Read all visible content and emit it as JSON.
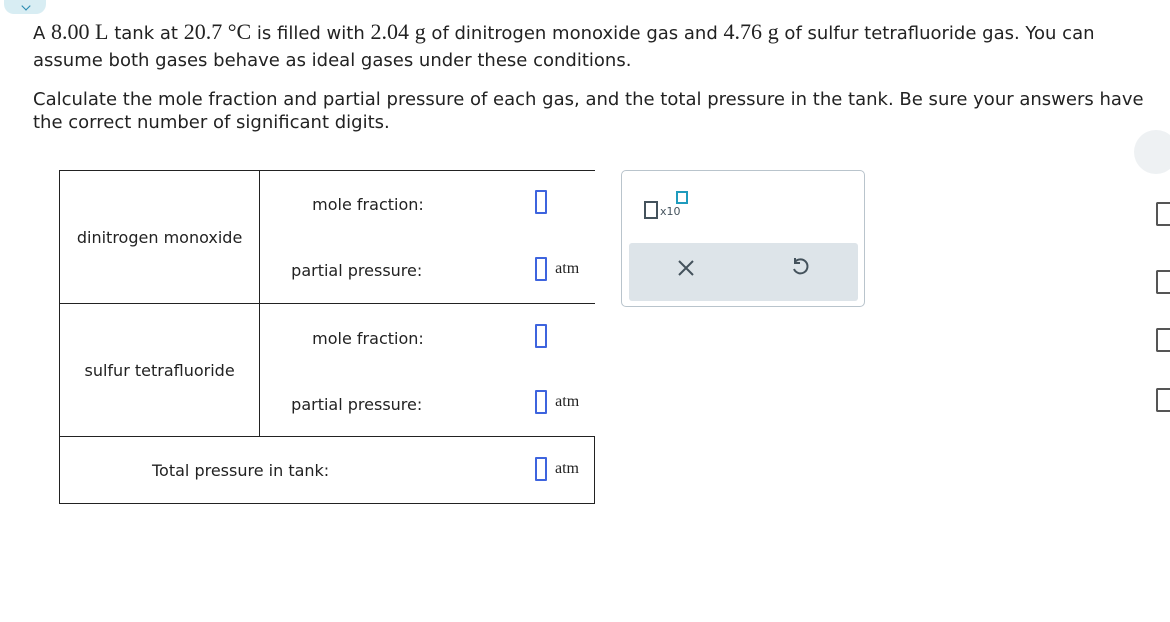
{
  "problem": {
    "seg1": "A ",
    "volume": "8.00 L",
    "seg2": " tank at ",
    "temperature": "20.7 °C",
    "seg3": " is filled with ",
    "mass1": "2.04",
    "unit_g1": "g",
    "seg4": " of dinitrogen monoxide gas and ",
    "mass2": "4.76",
    "unit_g2": "g",
    "seg5": " of sulfur tetrafluoride gas. You can assume both gases behave as ideal gases under these conditions.",
    "instruction": "Calculate the mole fraction and partial pressure of each gas, and the total pressure in the tank. Be sure your answers have the correct number of significant digits."
  },
  "table": {
    "gas1": "dinitrogen monoxide",
    "gas2": "sulfur tetrafluoride",
    "mole_fraction_label": "mole fraction:",
    "partial_pressure_label": "partial pressure:",
    "total_label": "Total pressure in tank:",
    "unit": "atm"
  },
  "tools": {
    "sci_label": "x10",
    "clear_icon": "x-icon",
    "undo_icon": "undo-icon"
  }
}
